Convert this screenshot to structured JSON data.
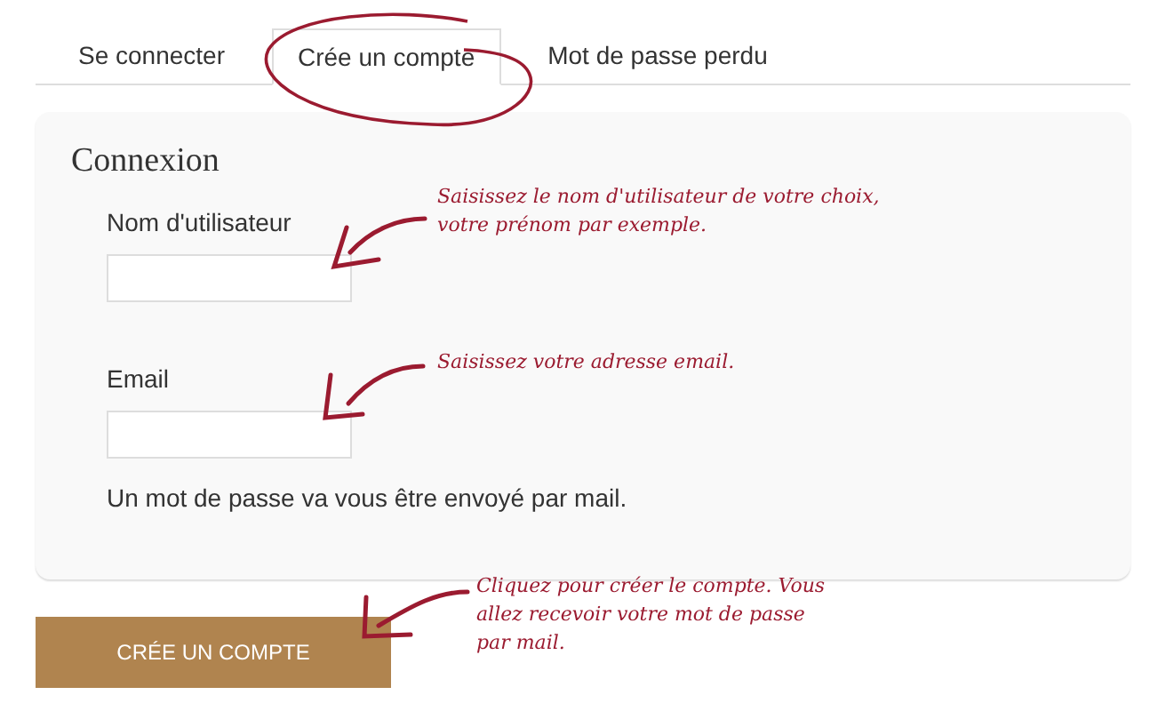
{
  "tabs": [
    {
      "label": "Se connecter",
      "selected": false
    },
    {
      "label": "Crée un compte",
      "selected": true
    },
    {
      "label": "Mot de passe perdu",
      "selected": false
    }
  ],
  "form": {
    "title": "Connexion",
    "fields": [
      {
        "label": "Nom d'utilisateur"
      },
      {
        "label": "Email"
      }
    ],
    "note": "Un mot de passe va vous être envoyé par mail."
  },
  "submit_button": "CRÉE UN COMPTE",
  "annotations": [
    {
      "lines": [
        "Saisissez le nom d'utilisateur de votre choix,",
        "votre prénom par exemple."
      ]
    },
    {
      "lines": [
        "Saisissez votre adresse email."
      ]
    },
    {
      "lines": [
        "Cliquez pour créer le compte. Vous",
        "allez recevoir votre mot de passe",
        "par mail."
      ]
    }
  ]
}
